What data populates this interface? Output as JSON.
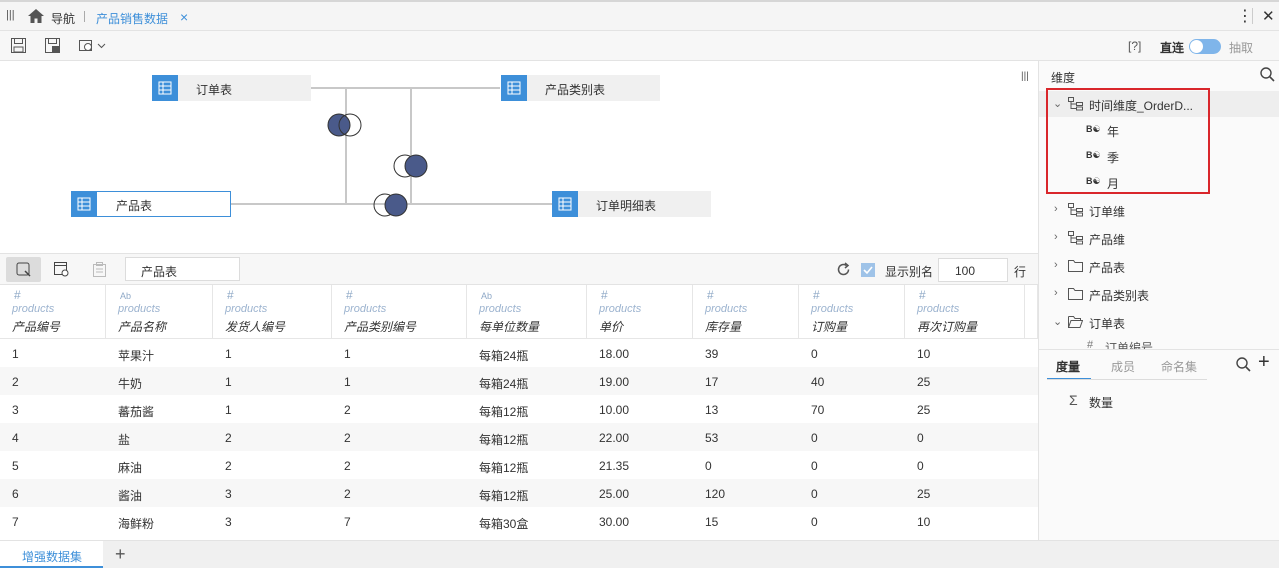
{
  "topbar": {
    "menu_icon": "menu-icon",
    "home_label": "导航",
    "active_tab": "产品销售数据",
    "close": "×",
    "more": "⋮"
  },
  "toolbar": {
    "help_label": "[?]",
    "direct_label": "直连",
    "extract_label": "抽取"
  },
  "diagram": {
    "nodes": [
      {
        "label": "订单表"
      },
      {
        "label": "产品类别表"
      },
      {
        "label": "产品表"
      },
      {
        "label": "订单明细表"
      }
    ]
  },
  "data_toolbar": {
    "table_field": "产品表",
    "show_alias_label": "显示别名",
    "rows_value": "100",
    "rows_unit": "行",
    "show_alias_checked": true
  },
  "grid": {
    "columns": [
      {
        "type": "#",
        "source": "products",
        "name": "产品编号"
      },
      {
        "type": "Ab",
        "source": "products",
        "name": "产品名称"
      },
      {
        "type": "#",
        "source": "products",
        "name": "发货人编号"
      },
      {
        "type": "#",
        "source": "products",
        "name": "产品类别编号"
      },
      {
        "type": "Ab",
        "source": "products",
        "name": "每单位数量"
      },
      {
        "type": "#",
        "source": "products",
        "name": "单价"
      },
      {
        "type": "#",
        "source": "products",
        "name": "库存量"
      },
      {
        "type": "#",
        "source": "products",
        "name": "订购量"
      },
      {
        "type": "#",
        "source": "products",
        "name": "再次订购量"
      }
    ],
    "rows": [
      [
        "1",
        "苹果汁",
        "1",
        "1",
        "每箱24瓶",
        "18.00",
        "39",
        "0",
        "10"
      ],
      [
        "2",
        "牛奶",
        "1",
        "1",
        "每箱24瓶",
        "19.00",
        "17",
        "40",
        "25"
      ],
      [
        "3",
        "蕃茄酱",
        "1",
        "2",
        "每箱12瓶",
        "10.00",
        "13",
        "70",
        "25"
      ],
      [
        "4",
        "盐",
        "2",
        "2",
        "每箱12瓶",
        "22.00",
        "53",
        "0",
        "0"
      ],
      [
        "5",
        "麻油",
        "2",
        "2",
        "每箱12瓶",
        "21.35",
        "0",
        "0",
        "0"
      ],
      [
        "6",
        "酱油",
        "3",
        "2",
        "每箱12瓶",
        "25.00",
        "120",
        "0",
        "25"
      ],
      [
        "7",
        "海鲜粉",
        "3",
        "7",
        "每箱30盒",
        "30.00",
        "15",
        "0",
        "10"
      ]
    ]
  },
  "bottom": {
    "tab_label": "增强数据集",
    "add": "+"
  },
  "right_panel": {
    "dimension_title": "维度",
    "time_dim": "时间维度_OrderD...",
    "time_children": [
      "年",
      "季",
      "月"
    ],
    "items": [
      "订单维",
      "产品维",
      "产品表",
      "产品类别表",
      "订单表"
    ],
    "partial_item": "订单编号",
    "tabs": [
      "度量",
      "成员",
      "命名集"
    ],
    "measure": "数量",
    "accent": "#3d8fd9",
    "highlight_box_color": "#d9262b"
  }
}
